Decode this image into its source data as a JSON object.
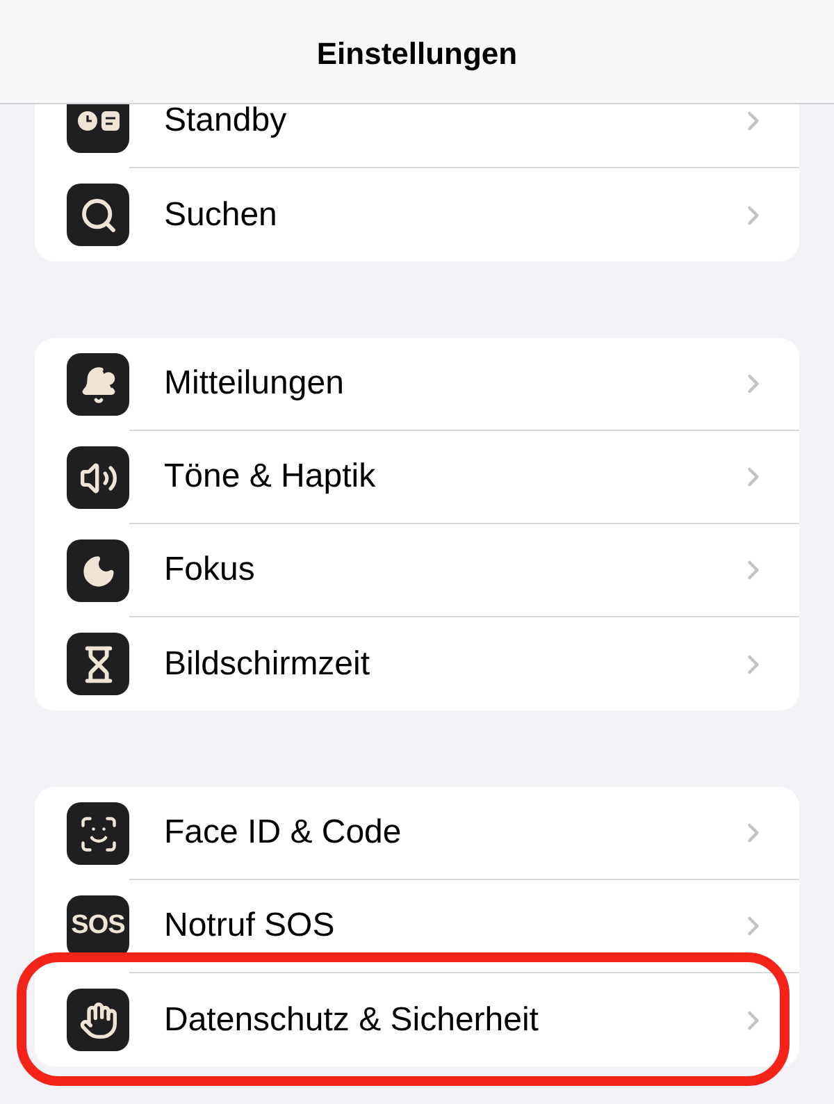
{
  "header": {
    "title": "Einstellungen"
  },
  "groups": [
    {
      "items": [
        {
          "label": "Standby",
          "highlighted": false
        },
        {
          "label": "Suchen",
          "highlighted": false
        }
      ]
    },
    {
      "items": [
        {
          "label": "Mitteilungen",
          "highlighted": false
        },
        {
          "label": "Töne & Haptik",
          "highlighted": false
        },
        {
          "label": "Fokus",
          "highlighted": false
        },
        {
          "label": "Bildschirmzeit",
          "highlighted": false
        }
      ]
    },
    {
      "items": [
        {
          "label": "Face ID & Code",
          "highlighted": false
        },
        {
          "label": "Notruf SOS",
          "icon_text": "SOS",
          "highlighted": false
        },
        {
          "label": "Datenschutz & Sicherheit",
          "highlighted": true
        }
      ]
    }
  ]
}
